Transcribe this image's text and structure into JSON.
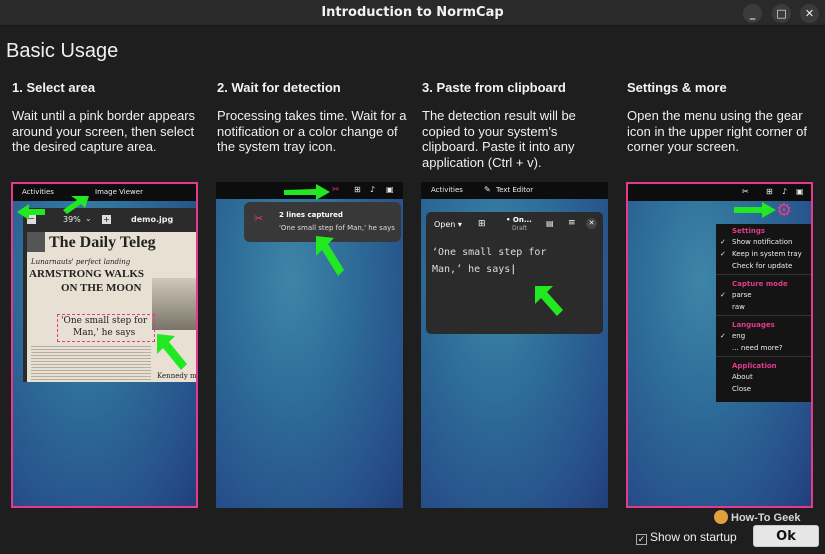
{
  "window": {
    "title": "Introduction to NormCap",
    "minimize": "_",
    "maximize": "□",
    "close": "✕"
  },
  "heading": "Basic Usage",
  "steps": [
    {
      "title": "1. Select area",
      "text": "Wait until a pink border appears around your screen, then select the desired capture area."
    },
    {
      "title": "2. Wait for detection",
      "text": "Processing takes time. Wait for a notification or a color change of the system tray icon."
    },
    {
      "title": "3. Paste from clipboard",
      "text": "The detection result will be copied to your system's clipboard. Paste it into any application (Ctrl + v)."
    },
    {
      "title": "Settings & more",
      "text": "Open the menu using the gear icon in the upper right corner of corner your screen."
    }
  ],
  "shot1": {
    "activities": "Activities",
    "app": "Image Viewer",
    "zoom": "39%",
    "filename": "demo.jpg",
    "newspaper_title": "The Daily Teleg",
    "sub": "Lunarnauts' perfect landing",
    "head1": "ARMSTRONG WALKS",
    "head2": "ON THE MOON",
    "quote1": "'One small step for",
    "quote2": "Man,' he says",
    "caption": "Kennedy ma"
  },
  "shot2": {
    "notif_title": "2 lines captured",
    "notif_text": "'One small step fof Man,' he says"
  },
  "shot3": {
    "activities": "Activities",
    "app": "Text Editor",
    "open": "Open",
    "doc_name": "• On...",
    "doc_state": "Draft",
    "line1": "‘One small step for",
    "line2": "Man,’ he says"
  },
  "shot4": {
    "menu": [
      {
        "type": "section",
        "label": "Settings"
      },
      {
        "type": "item",
        "label": "Show notification",
        "checked": true
      },
      {
        "type": "item",
        "label": "Keep in system tray",
        "checked": true
      },
      {
        "type": "item",
        "label": "Check for update",
        "checked": false
      },
      {
        "type": "section",
        "label": "Capture mode"
      },
      {
        "type": "item",
        "label": "parse",
        "checked": true
      },
      {
        "type": "item",
        "label": "raw",
        "checked": false
      },
      {
        "type": "section",
        "label": "Languages"
      },
      {
        "type": "item",
        "label": "eng",
        "checked": true
      },
      {
        "type": "item",
        "label": "... need more?",
        "checked": false
      },
      {
        "type": "section",
        "label": "Application"
      },
      {
        "type": "item",
        "label": "About",
        "checked": false
      },
      {
        "type": "item",
        "label": "Close",
        "checked": false
      }
    ]
  },
  "footer": {
    "show_on_startup": "Show on startup",
    "show_on_startup_checked": true,
    "ok": "Ok",
    "watermark": "How-To Geek"
  },
  "colors": {
    "accent_pink": "#e5398f",
    "arrow_green": "#22e822"
  }
}
